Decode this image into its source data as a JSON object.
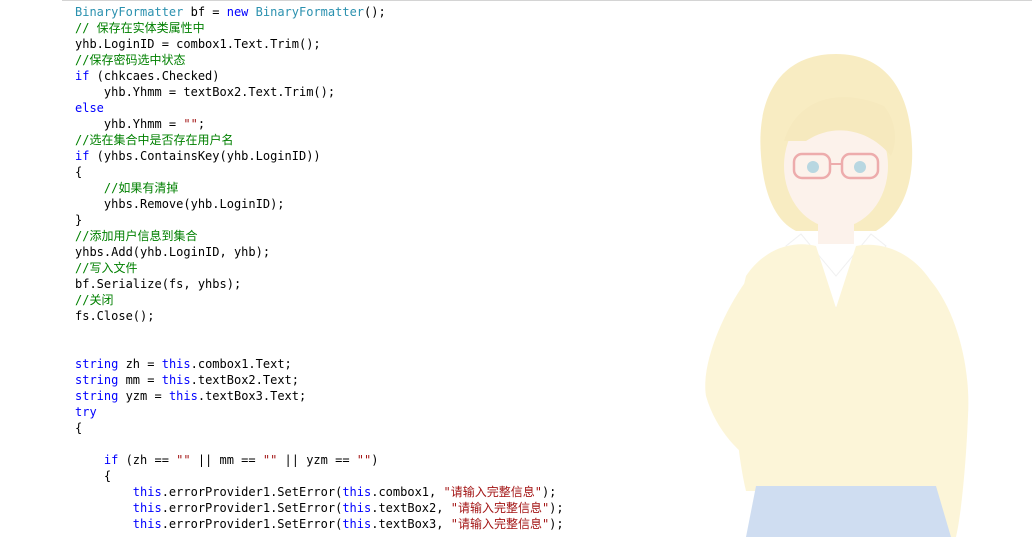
{
  "editor": {
    "lines": [
      [
        {
          "t": "t",
          "v": "BinaryFormatter"
        },
        {
          "t": "p",
          "v": " bf = "
        },
        {
          "t": "k",
          "v": "new"
        },
        {
          "t": "p",
          "v": " "
        },
        {
          "t": "t",
          "v": "BinaryFormatter"
        },
        {
          "t": "p",
          "v": "();"
        }
      ],
      [
        {
          "t": "c",
          "v": "// 保存在实体类属性中"
        }
      ],
      [
        {
          "t": "p",
          "v": "yhb.LoginID = combox1.Text.Trim();"
        }
      ],
      [
        {
          "t": "c",
          "v": "//保存密码选中状态"
        }
      ],
      [
        {
          "t": "k",
          "v": "if"
        },
        {
          "t": "p",
          "v": " (chkcaes.Checked)"
        }
      ],
      [
        {
          "t": "p",
          "v": "    yhb.Yhmm = textBox2.Text.Trim();"
        }
      ],
      [
        {
          "t": "k",
          "v": "else"
        }
      ],
      [
        {
          "t": "p",
          "v": "    yhb.Yhmm = "
        },
        {
          "t": "s",
          "v": "\"\""
        },
        {
          "t": "p",
          "v": ";"
        }
      ],
      [
        {
          "t": "c",
          "v": "//选在集合中是否存在用户名"
        }
      ],
      [
        {
          "t": "k",
          "v": "if"
        },
        {
          "t": "p",
          "v": " (yhbs.ContainsKey(yhb.LoginID))"
        }
      ],
      [
        {
          "t": "p",
          "v": "{"
        }
      ],
      [
        {
          "t": "p",
          "v": "    "
        },
        {
          "t": "c",
          "v": "//如果有清掉"
        }
      ],
      [
        {
          "t": "p",
          "v": "    yhbs.Remove(yhb.LoginID);"
        }
      ],
      [
        {
          "t": "p",
          "v": "}"
        }
      ],
      [
        {
          "t": "c",
          "v": "//添加用户信息到集合"
        }
      ],
      [
        {
          "t": "p",
          "v": "yhbs.Add(yhb.LoginID, yhb);"
        }
      ],
      [
        {
          "t": "c",
          "v": "//写入文件"
        }
      ],
      [
        {
          "t": "p",
          "v": "bf.Serialize(fs, yhbs);"
        }
      ],
      [
        {
          "t": "c",
          "v": "//关闭"
        }
      ],
      [
        {
          "t": "p",
          "v": "fs.Close();"
        }
      ],
      [],
      [],
      [
        {
          "t": "k",
          "v": "string"
        },
        {
          "t": "p",
          "v": " zh = "
        },
        {
          "t": "k",
          "v": "this"
        },
        {
          "t": "p",
          "v": ".combox1.Text;"
        }
      ],
      [
        {
          "t": "k",
          "v": "string"
        },
        {
          "t": "p",
          "v": " mm = "
        },
        {
          "t": "k",
          "v": "this"
        },
        {
          "t": "p",
          "v": ".textBox2.Text;"
        }
      ],
      [
        {
          "t": "k",
          "v": "string"
        },
        {
          "t": "p",
          "v": " yzm = "
        },
        {
          "t": "k",
          "v": "this"
        },
        {
          "t": "p",
          "v": ".textBox3.Text;"
        }
      ],
      [
        {
          "t": "k",
          "v": "try"
        }
      ],
      [
        {
          "t": "p",
          "v": "{"
        }
      ],
      [],
      [
        {
          "t": "p",
          "v": "    "
        },
        {
          "t": "k",
          "v": "if"
        },
        {
          "t": "p",
          "v": " (zh == "
        },
        {
          "t": "s",
          "v": "\"\""
        },
        {
          "t": "p",
          "v": " || mm == "
        },
        {
          "t": "s",
          "v": "\"\""
        },
        {
          "t": "p",
          "v": " || yzm == "
        },
        {
          "t": "s",
          "v": "\"\""
        },
        {
          "t": "p",
          "v": ")"
        }
      ],
      [
        {
          "t": "p",
          "v": "    {"
        }
      ],
      [
        {
          "t": "p",
          "v": "        "
        },
        {
          "t": "k",
          "v": "this"
        },
        {
          "t": "p",
          "v": ".errorProvider1.SetError("
        },
        {
          "t": "k",
          "v": "this"
        },
        {
          "t": "p",
          "v": ".combox1, "
        },
        {
          "t": "s",
          "v": "\"请输入完整信息\""
        },
        {
          "t": "p",
          "v": ");"
        }
      ],
      [
        {
          "t": "p",
          "v": "        "
        },
        {
          "t": "k",
          "v": "this"
        },
        {
          "t": "p",
          "v": ".errorProvider1.SetError("
        },
        {
          "t": "k",
          "v": "this"
        },
        {
          "t": "p",
          "v": ".textBox2, "
        },
        {
          "t": "s",
          "v": "\"请输入完整信息\""
        },
        {
          "t": "p",
          "v": ");"
        }
      ],
      [
        {
          "t": "p",
          "v": "        "
        },
        {
          "t": "k",
          "v": "this"
        },
        {
          "t": "p",
          "v": ".errorProvider1.SetError("
        },
        {
          "t": "k",
          "v": "this"
        },
        {
          "t": "p",
          "v": ".textBox3, "
        },
        {
          "t": "s",
          "v": "\"请输入完整信息\""
        },
        {
          "t": "p",
          "v": ");"
        }
      ]
    ]
  },
  "colors": {
    "keyword": "#0000ff",
    "type": "#2b91af",
    "comment": "#008000",
    "string": "#a31515",
    "plain": "#000000"
  },
  "background_image": "anime-girl-with-red-glasses",
  "watermark": ""
}
